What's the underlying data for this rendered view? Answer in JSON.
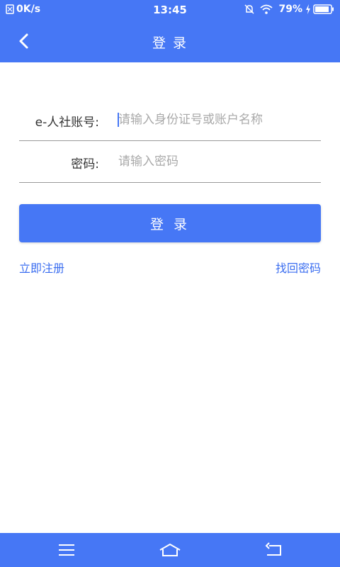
{
  "status_bar": {
    "speed": "0K/s",
    "time": "13:45",
    "battery": "79%"
  },
  "nav": {
    "title": "登 录"
  },
  "form": {
    "account_label": "e-人社账号:",
    "account_placeholder": "请输入身份证号或账户名称",
    "password_label": "密码:",
    "password_placeholder": "请输入密码"
  },
  "login_button": "登 录",
  "links": {
    "register": "立即注册",
    "recover_password": "找回密码"
  },
  "icons": {
    "back": "chevron-left-icon",
    "menu": "menu-icon",
    "home": "home-icon",
    "system_back": "return-icon"
  },
  "colors": {
    "primary": "#4677f5",
    "link": "#3a6df0"
  }
}
